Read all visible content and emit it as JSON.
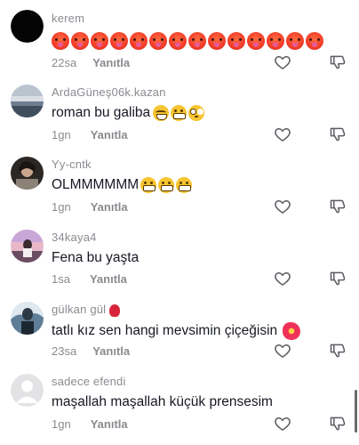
{
  "comments": [
    {
      "username": "kerem",
      "text": "",
      "emojis": [
        "hot-face",
        "hot-face",
        "hot-face",
        "hot-face",
        "hot-face",
        "hot-face",
        "hot-face",
        "hot-face",
        "hot-face",
        "hot-face",
        "hot-face",
        "hot-face",
        "hot-face",
        "hot-face"
      ],
      "time": "22sa",
      "reply_label": "Yanıtla",
      "avatar": "black-circle"
    },
    {
      "username": "ArdaGüneş06k.kazan",
      "text": "roman bu galiba",
      "emojis": [
        "laughing-tears",
        "grinning",
        "flushed"
      ],
      "time": "1gn",
      "reply_label": "Yanıtla",
      "avatar": "landscape"
    },
    {
      "username": "Yy-cntk",
      "text": "OLMMMMMM",
      "emojis": [
        "grinning",
        "grinning",
        "grinning"
      ],
      "time": "1gn",
      "reply_label": "Yanıtla",
      "avatar": "person-photo"
    },
    {
      "username": "34kaya4",
      "text": "Fena bu yaşta",
      "emojis": [],
      "time": "1sa",
      "reply_label": "Yanıtla",
      "avatar": "pink-sky"
    },
    {
      "username": "gülkan gül",
      "username_emoji": "rose",
      "text": "tatlı kız sen hangi mevsimin çiçeğisin",
      "emojis": [
        "hibiscus"
      ],
      "time": "23sa",
      "reply_label": "Yanıtla",
      "avatar": "illustration"
    },
    {
      "username": "sadece efendi",
      "text": "maşallah maşallah küçük prensesim",
      "emojis": [],
      "time": "1gn",
      "reply_label": "Yanıtla",
      "avatar": "default-gray"
    }
  ],
  "icons": {
    "like": "heart-outline-icon",
    "dislike": "thumbs-down-outline-icon"
  },
  "colors": {
    "username": "#8a8b91",
    "text": "#161823",
    "meta": "#8a8b91"
  }
}
